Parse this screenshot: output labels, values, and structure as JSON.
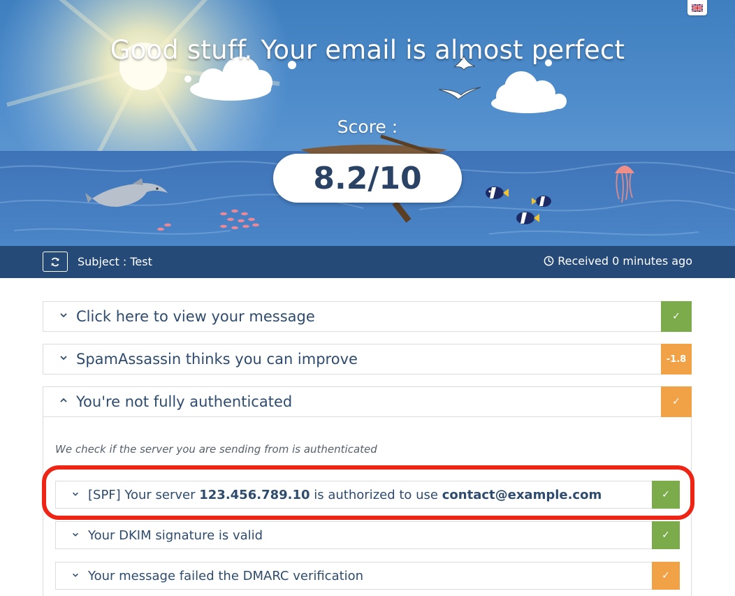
{
  "hero": {
    "title": "Good stuff. Your email is almost perfect",
    "score_label": "Score :",
    "score_value": "8.2/10",
    "language_flag": "uk-flag-icon"
  },
  "subject_bar": {
    "refresh_icon": "refresh-icon",
    "subject": "Subject : Test",
    "received": "Received 0 minutes ago",
    "clock_icon": "clock-icon"
  },
  "panels": [
    {
      "label": "Click here to view your message",
      "badge": "✓",
      "badge_color": "#7cab4c",
      "expanded": false
    },
    {
      "label": "SpamAssassin thinks you can improve",
      "badge": "-1.8",
      "badge_color": "#f2a246",
      "expanded": false
    },
    {
      "label": "You're not fully authenticated",
      "badge": "✓",
      "badge_color": "#f2a246",
      "expanded": true
    }
  ],
  "auth": {
    "description": "We check if the server you are sending from is authenticated",
    "items": [
      {
        "prefix": "[SPF] Your server ",
        "ip": "123.456.789.10",
        "middle": " is authorized to use ",
        "email": "contact@example.com",
        "badge": "✓",
        "badge_color": "#7cab4c",
        "highlighted": true
      },
      {
        "label": "Your DKIM signature is valid",
        "badge": "✓",
        "badge_color": "#7cab4c"
      },
      {
        "label": "Your message failed the DMARC verification",
        "badge": "✓",
        "badge_color": "#f2a246"
      }
    ]
  },
  "colors": {
    "header_bar": "#264a78",
    "highlight": "#ee2415",
    "panel_text": "#2e4b6e"
  }
}
